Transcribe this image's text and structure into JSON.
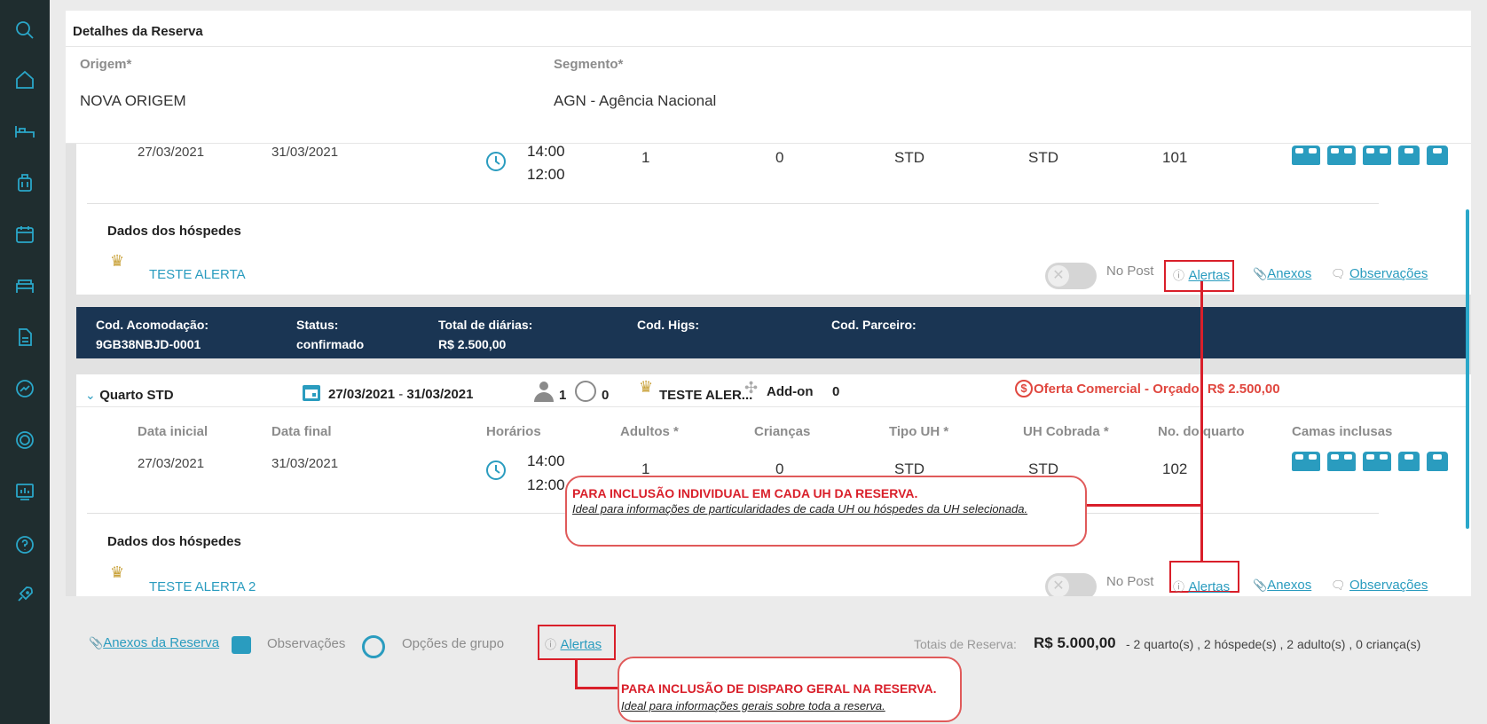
{
  "sidebar": {
    "icons": [
      "search-icon",
      "home-icon",
      "bed-icon",
      "luggage-icon",
      "calendar-icon",
      "bed-double-icon",
      "document-icon",
      "chart-icon",
      "target-icon",
      "dashboard-icon",
      "help-icon",
      "rocket-icon"
    ]
  },
  "header": {
    "title": "Detalhes da Reserva",
    "origem_label": "Origem*",
    "origem_value": "NOVA ORIGEM",
    "segmento_label": "Segmento*",
    "segmento_value": "AGN - Agência Nacional"
  },
  "room1": {
    "date_start": "27/03/2021",
    "date_end": "31/03/2021",
    "time_in": "14:00",
    "time_out": "12:00",
    "adults": "1",
    "children": "0",
    "tipo_uh": "STD",
    "uh_cobrada": "STD",
    "room_no": "101",
    "guests_title": "Dados dos hóspedes",
    "guest_name": "TESTE ALERTA",
    "nopost": "No Post",
    "alertas": "Alertas",
    "anexos": "Anexos",
    "observacoes": "Observações"
  },
  "accommodation_bar": {
    "cod_label": "Cod. Acomodação:",
    "cod_value": "9GB38NBJD-0001",
    "status_label": "Status:",
    "status_value": "confirmado",
    "total_label": "Total de diárias:",
    "total_value": "R$ 2.500,00",
    "higs_label": "Cod. Higs:",
    "parceiro_label": "Cod. Parceiro:"
  },
  "room2": {
    "title": "Quarto STD",
    "date_range_start": "27/03/2021",
    "date_range_sep": "-",
    "date_range_end": "31/03/2021",
    "adults_count": "1",
    "children_count": "0",
    "guest_short": "TESTE ALER...",
    "addon_label": "Add-on",
    "addon_count": "0",
    "offer": "Oferta Comercial - Orçado: R$ 2.500,00",
    "columns": [
      "Data inicial",
      "Data final",
      "Horários",
      "Adultos *",
      "Crianças",
      "Tipo UH *",
      "UH Cobrada *",
      "No. do quarto",
      "Camas inclusas"
    ],
    "date_start": "27/03/2021",
    "date_end": "31/03/2021",
    "time_in": "14:00",
    "time_out": "12:00",
    "adults": "1",
    "children": "0",
    "tipo_uh": "STD",
    "uh_cobrada": "STD",
    "room_no": "102",
    "guests_title": "Dados dos hóspedes",
    "guest_name": "TESTE ALERTA 2",
    "nopost": "No Post",
    "alertas": "Alertas",
    "anexos": "Anexos",
    "observacoes": "Observações"
  },
  "callout1": {
    "title": "PARA INCLUSÃO INDIVIDUAL EM CADA UH DA RESERVA.",
    "subtitle": "Ideal para informações de particularidades de cada UH ou hóspedes da UH selecionada."
  },
  "callout2": {
    "title": "PARA INCLUSÃO DE DISPARO GERAL NA RESERVA.",
    "subtitle": "Ideal para informações gerais sobre toda a reserva."
  },
  "footer": {
    "anexos_reserva": "Anexos da Reserva",
    "observacoes": "Observações",
    "opcoes_grupo": "Opções de grupo",
    "alertas": "Alertas",
    "totals_label": "Totais de Reserva:",
    "totals_value": "R$ 5.000,00",
    "totals_detail": "- 2 quarto(s) , 2 hóspede(s) , 2 adulto(s) , 0 criança(s)"
  },
  "colors": {
    "accent": "#2a9cbf",
    "navy": "#1a3553",
    "red": "#d91f2a",
    "sidebar": "#1f2d2f"
  }
}
